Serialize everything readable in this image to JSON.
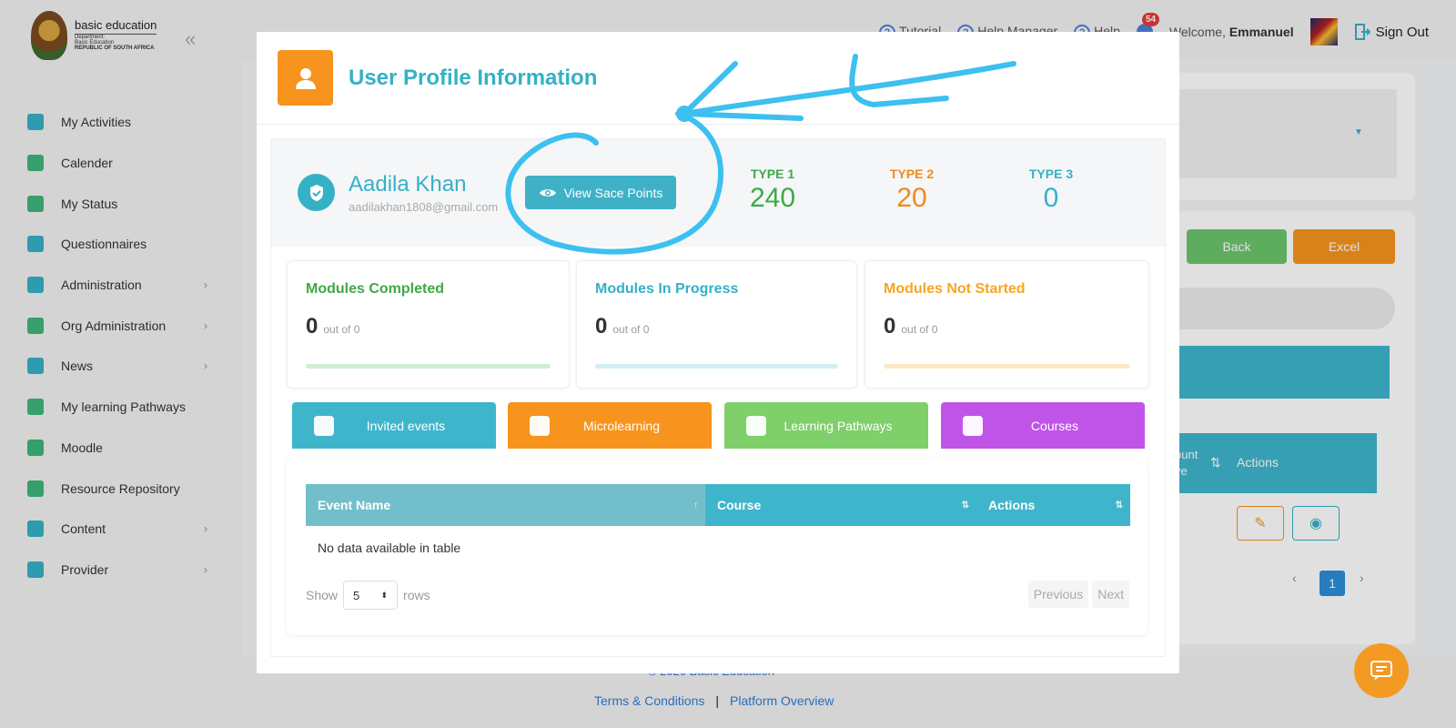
{
  "brand": {
    "name": "basic education",
    "sub1": "Department:",
    "sub2": "Basic Education",
    "sub3": "REPUBLIC OF SOUTH AFRICA"
  },
  "sidebar": {
    "items": [
      {
        "label": "My Activities",
        "icon": "home-icon",
        "color": "#35b1c6"
      },
      {
        "label": "Calender",
        "icon": "calendar-icon",
        "color": "#3fb57a"
      },
      {
        "label": "My Status",
        "icon": "status-icon",
        "color": "#3fb57a"
      },
      {
        "label": "Questionnaires",
        "icon": "questionnaire-icon",
        "color": "#35b1c6"
      },
      {
        "label": "Administration",
        "icon": "folder-icon",
        "color": "#35b1c6"
      },
      {
        "label": "Org Administration",
        "icon": "folders-icon",
        "color": "#3fb57a"
      },
      {
        "label": "News",
        "icon": "news-icon",
        "color": "#35b1c6"
      },
      {
        "label": "My learning Pathways",
        "icon": "graduation-icon",
        "color": "#3fb57a"
      },
      {
        "label": "Moodle",
        "icon": "moodle-icon",
        "color": "#3fb57a"
      },
      {
        "label": "Resource Repository",
        "icon": "download-icon",
        "color": "#3fb57a"
      },
      {
        "label": "Content",
        "icon": "clipboard-icon",
        "color": "#35b1c6"
      },
      {
        "label": "Provider",
        "icon": "provider-icon",
        "color": "#35b1c6"
      }
    ]
  },
  "topbar": {
    "tutorial": "Tutorial",
    "help_manager": "Help Manager",
    "help": "Help",
    "notif_count": "54",
    "welcome": "Welcome,",
    "user": "Emmanuel",
    "sign_out": "Sign Out"
  },
  "background": {
    "back": "Back",
    "excel": "Excel",
    "col_count_a": "ount",
    "col_count_b": "ve",
    "actions": "Actions",
    "page": "1"
  },
  "footer": {
    "copyright": "© 2020 Basic Education",
    "terms": "Terms & Conditions",
    "sep": "|",
    "overview": "Platform Overview"
  },
  "modal": {
    "title": "User Profile Information",
    "name": "Aadila Khan",
    "email": "aadilakhan1808@gmail.com",
    "view_btn": "View Sace Points",
    "types": [
      {
        "label": "TYPE 1",
        "value": "240",
        "color": "#3fa945"
      },
      {
        "label": "TYPE 2",
        "value": "20",
        "color": "#ef8a1d"
      },
      {
        "label": "TYPE 3",
        "value": "0",
        "color": "#35b1c6"
      }
    ],
    "modules": [
      {
        "title": "Modules Completed",
        "count": "0",
        "out": "out of 0",
        "color": "#3fa945",
        "bar": "#cfeed0"
      },
      {
        "title": "Modules In Progress",
        "count": "0",
        "out": "out of 0",
        "color": "#35b1c6",
        "bar": "#d3eef3"
      },
      {
        "title": "Modules Not Started",
        "count": "0",
        "out": "out of 0",
        "color": "#f5a623",
        "bar": "#fde9c4"
      }
    ],
    "tabs": [
      {
        "label": "Invited events",
        "color": "#3fb5cc"
      },
      {
        "label": "Microlearning",
        "color": "#f7941d"
      },
      {
        "label": "Learning Pathways",
        "color": "#7fcf6a"
      },
      {
        "label": "Courses",
        "color": "#c054e8"
      }
    ],
    "table": {
      "headers": [
        "Event Name",
        "Course",
        "Actions"
      ],
      "empty": "No data available in table",
      "show": "Show",
      "rows_value": "5",
      "rows": "rows",
      "previous": "Previous",
      "next": "Next"
    }
  }
}
